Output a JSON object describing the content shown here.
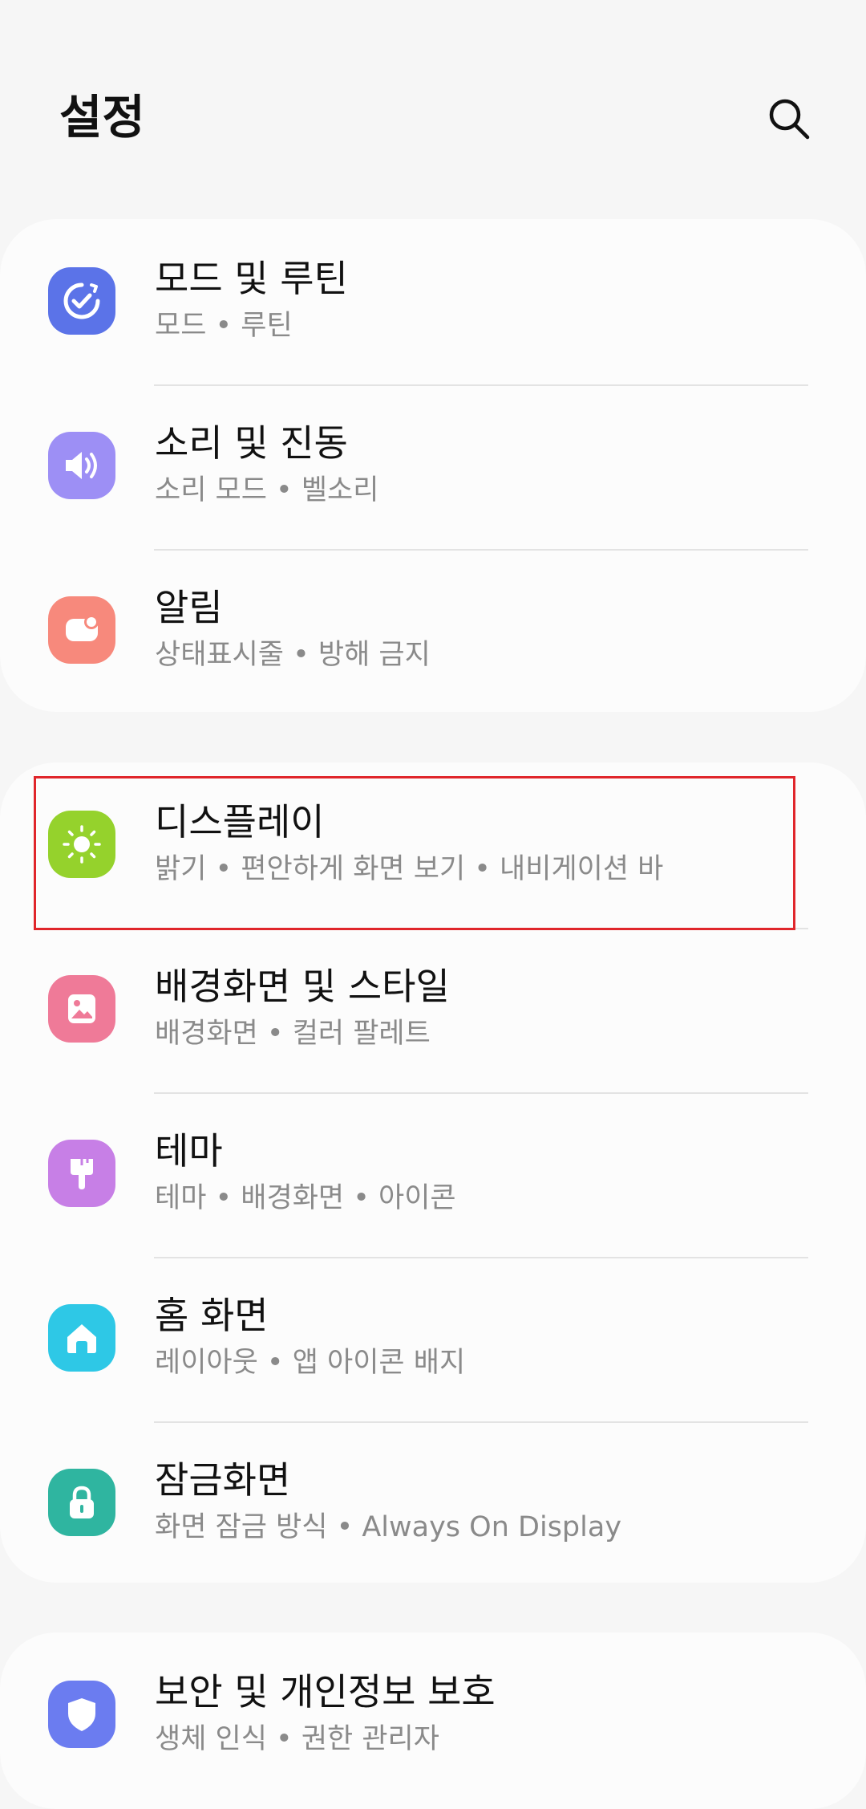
{
  "header": {
    "title": "설정",
    "search_icon": "search-icon"
  },
  "groups": [
    {
      "items": [
        {
          "title": "모드 및 루틴",
          "subtitle": "모드  •  루틴",
          "icon": "modes-routines-icon",
          "color": "#5b73e8"
        },
        {
          "title": "소리 및 진동",
          "subtitle": "소리 모드  •  벨소리",
          "icon": "volume-icon",
          "color": "#9d8ff5"
        },
        {
          "title": "알림",
          "subtitle": "상태표시줄  •  방해 금지",
          "icon": "notification-icon",
          "color": "#f7897c"
        }
      ]
    },
    {
      "items": [
        {
          "title": "디스플레이",
          "subtitle": "밝기  •  편안하게 화면 보기  •  내비게이션 바",
          "icon": "display-brightness-icon",
          "color": "#95d22c"
        },
        {
          "title": "배경화면 및 스타일",
          "subtitle": "배경화면  •  컬러 팔레트",
          "icon": "wallpaper-icon",
          "color": "#ef7a98"
        },
        {
          "title": "테마",
          "subtitle": "테마  •  배경화면  •  아이콘",
          "icon": "theme-brush-icon",
          "color": "#c77fe6"
        },
        {
          "title": "홈 화면",
          "subtitle": "레이아웃  •  앱 아이콘 배지",
          "icon": "home-icon",
          "color": "#2ec8e6"
        },
        {
          "title": "잠금화면",
          "subtitle": "화면 잠금 방식  •  Always On Display",
          "icon": "lock-icon",
          "color": "#2fb5a0"
        }
      ]
    },
    {
      "items": [
        {
          "title": "보안 및 개인정보 보호",
          "subtitle": "생체 인식  •  권한 관리자",
          "icon": "shield-icon",
          "color": "#6b7cf0"
        }
      ]
    }
  ]
}
